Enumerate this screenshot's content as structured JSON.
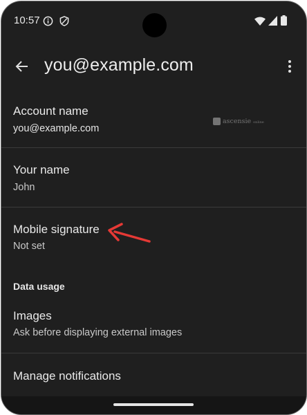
{
  "status_bar": {
    "time": "10:57"
  },
  "app_bar": {
    "title": "you@example.com"
  },
  "settings": {
    "account_name": {
      "title": "Account name",
      "value": "you@example.com"
    },
    "your_name": {
      "title": "Your name",
      "value": "John"
    },
    "mobile_signature": {
      "title": "Mobile signature",
      "value": "Not set"
    },
    "data_usage_header": "Data usage",
    "images": {
      "title": "Images",
      "value": "Ask before displaying external images"
    },
    "manage_notifications": {
      "title": "Manage notifications"
    }
  },
  "watermark": {
    "brand": "ascensie",
    "suffix": "online"
  },
  "colors": {
    "background": "#1f1f1f",
    "annotation_arrow": "#e53935"
  }
}
